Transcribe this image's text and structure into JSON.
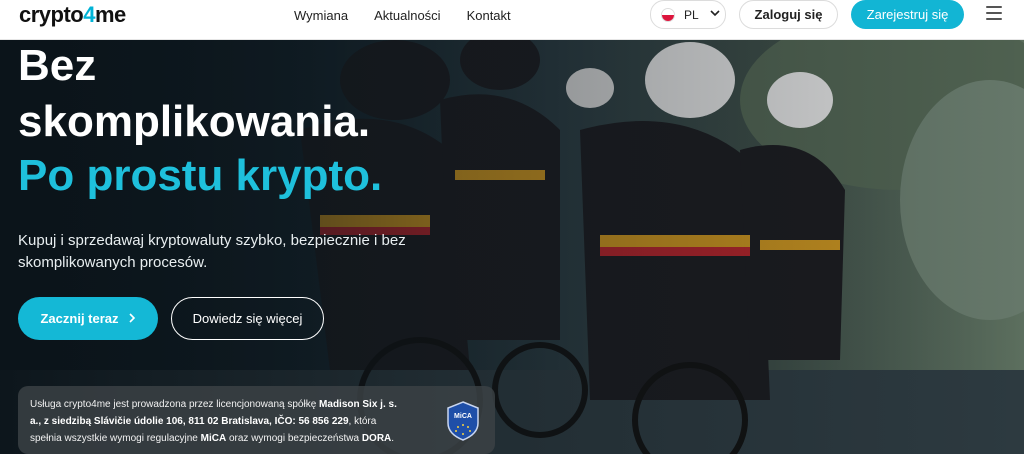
{
  "header": {
    "logo_prefix": "crypto",
    "logo_accent": "4",
    "logo_suffix": "me",
    "nav": [
      "Wymiana",
      "Aktualności",
      "Kontakt"
    ],
    "language": "PL",
    "login_label": "Zaloguj się",
    "register_label": "Zarejestruj się",
    "icons": {
      "language": "poland-flag-icon",
      "dropdown": "chevron-down-icon",
      "menu": "hamburger-menu-icon"
    }
  },
  "hero": {
    "title_line1": "Bez",
    "title_line2": "skomplikowania.",
    "title_line3": "Po prostu krypto.",
    "subtitle": "Kupuj i sprzedawaj kryptowaluty szybko, bezpiecznie i bez skomplikowanych procesów.",
    "cta_primary": "Zacznij teraz",
    "cta_secondary": "Dowiedz się więcej"
  },
  "license": {
    "t1": "Usługa crypto4me jest prowadzona przez licencjonowaną spółkę ",
    "b1": "Madison Six j. s. a., z siedzibą Slávičie údolie 106, 811 02 Bratislava, IČO: 56 856 229",
    "t2": ", która spełnia wszystkie wymogi regulacyjne ",
    "b2": "MiCA",
    "t3": " oraz wymogi bezpieczeństwa ",
    "b3": "DORA",
    "t4": ".",
    "badge_label": "MiCA"
  },
  "colors": {
    "accent": "#12b5d4",
    "title_accent": "#1ec0dc",
    "header_bg": "#ffffff"
  }
}
